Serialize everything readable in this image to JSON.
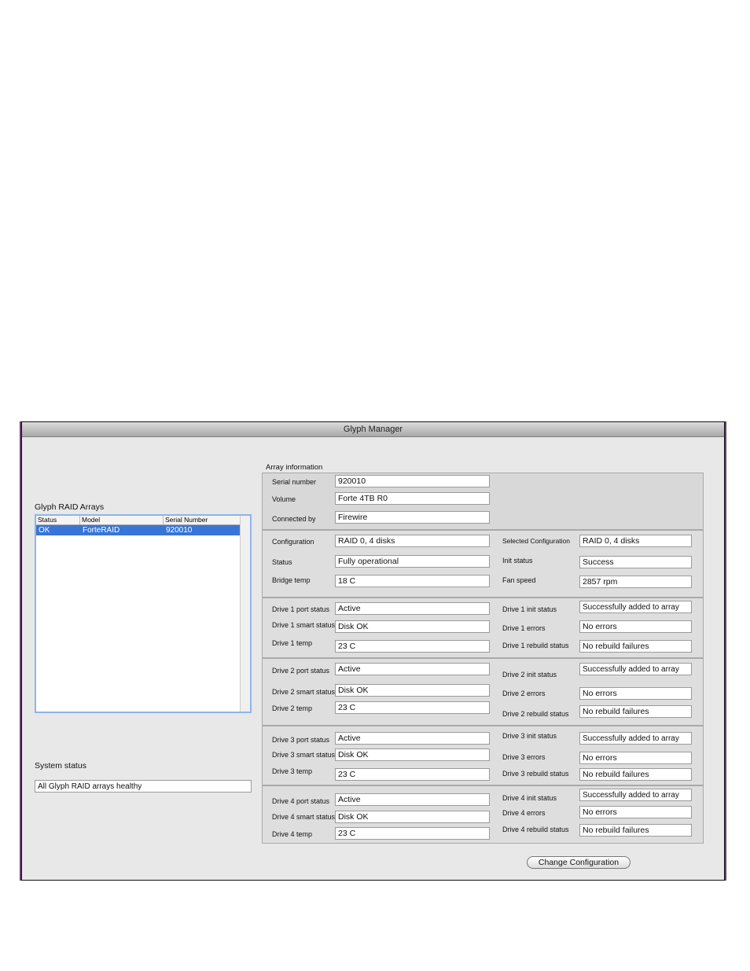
{
  "window": {
    "title": "Glyph Manager"
  },
  "arrays": {
    "heading": "Glyph RAID Arrays",
    "columns": [
      "Status",
      "Model",
      "Serial Number"
    ],
    "rows": [
      {
        "status": "OK",
        "model": "ForteRAID",
        "serial": "920010"
      }
    ]
  },
  "system": {
    "heading": "System status",
    "value": "All Glyph RAID arrays healthy"
  },
  "info": {
    "heading": "Array information",
    "serial_label": "Serial number",
    "serial_value": "920010",
    "volume_label": "Volume",
    "volume_value": "Forte 4TB R0",
    "connected_label": "Connected by",
    "connected_value": "Firewire"
  },
  "config": {
    "config_label": "Configuration",
    "config_value": "RAID 0, 4 disks",
    "status_label": "Status",
    "status_value": "Fully operational",
    "bridge_label": "Bridge temp",
    "bridge_value": "18 C",
    "selected_label": "Selected Configuration",
    "selected_value": "RAID 0, 4 disks",
    "init_label": "Init status",
    "init_value": "Success",
    "fan_label": "Fan speed",
    "fan_value": "2857 rpm"
  },
  "drives": [
    {
      "port_label": "Drive 1 port status",
      "port_value": "Active",
      "smart_label": "Drive 1 smart status",
      "smart_value": "Disk OK",
      "temp_label": "Drive 1 temp",
      "temp_value": "23 C",
      "init_label": "Drive 1 init status",
      "init_value": "Successfully added to array",
      "errors_label": "Drive 1 errors",
      "errors_value": "No errors",
      "rebuild_label": "Drive 1 rebuild status",
      "rebuild_value": "No rebuild failures"
    },
    {
      "port_label": "Drive 2 port status",
      "port_value": "Active",
      "smart_label": "Drive 2 smart status",
      "smart_value": "Disk OK",
      "temp_label": "Drive 2 temp",
      "temp_value": "23 C",
      "init_label": "Drive 2 init status",
      "init_value": "Successfully added to array",
      "errors_label": "Drive 2 errors",
      "errors_value": "No errors",
      "rebuild_label": "Drive 2 rebuild status",
      "rebuild_value": "No rebuild failures"
    },
    {
      "port_label": "Drive 3 port status",
      "port_value": "Active",
      "smart_label": "Drive 3 smart status",
      "smart_value": "Disk OK",
      "temp_label": "Drive 3 temp",
      "temp_value": "23 C",
      "init_label": "Drive 3 init status",
      "init_value": "Successfully added to array",
      "errors_label": "Drive 3 errors",
      "errors_value": "No errors",
      "rebuild_label": "Drive 3 rebuild status",
      "rebuild_value": "No rebuild failures"
    },
    {
      "port_label": "Drive 4 port status",
      "port_value": "Active",
      "smart_label": "Drive 4 smart status",
      "smart_value": "Disk OK",
      "temp_label": "Drive 4 temp",
      "temp_value": "23 C",
      "init_label": "Drive 4 init status",
      "init_value": "Successfully added to array",
      "errors_label": "Drive 4 errors",
      "errors_value": "No errors",
      "rebuild_label": "Drive 4 rebuild status",
      "rebuild_value": "No rebuild failures"
    }
  ],
  "actions": {
    "change_config_label": "Change Configuration"
  }
}
